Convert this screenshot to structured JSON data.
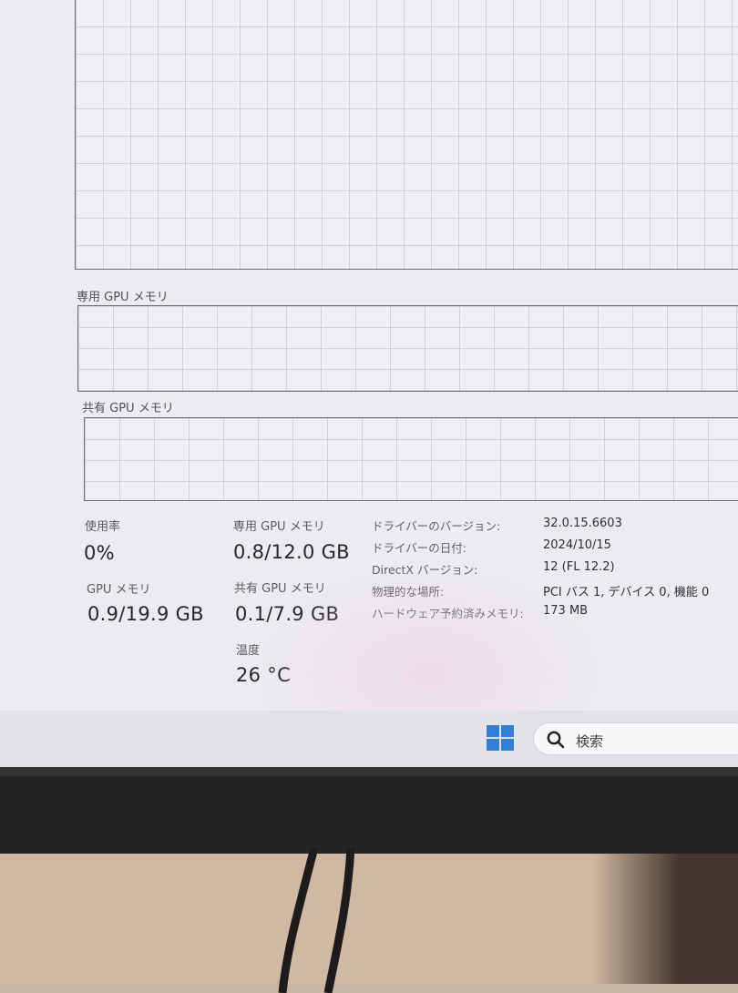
{
  "graphs": {
    "dedicated_label": "専用 GPU メモリ",
    "shared_label": "共有 GPU メモリ"
  },
  "stats": {
    "usage_label": "使用率",
    "usage_value": "0%",
    "gpu_memory_label": "GPU メモリ",
    "gpu_memory_value": "0.9/19.9 GB",
    "dedicated_label": "専用 GPU メモリ",
    "dedicated_value": "0.8/12.0 GB",
    "shared_label": "共有 GPU メモリ",
    "shared_value": "0.1/7.9 GB",
    "temp_label": "温度",
    "temp_value": "26 °C"
  },
  "info": {
    "driver_version_label": "ドライバーのバージョン:",
    "driver_version_value": "32.0.15.6603",
    "driver_date_label": "ドライバーの日付:",
    "driver_date_value": "2024/10/15",
    "directx_label": "DirectX バージョン:",
    "directx_value": "12 (FL 12.2)",
    "location_label": "物理的な場所:",
    "location_value": "PCI バス 1, デバイス 0, 機能 0",
    "reserved_label": "ハードウェア予約済みメモリ:",
    "reserved_value": "173 MB"
  },
  "taskbar": {
    "start_icon": "windows-logo-icon",
    "search_icon": "search-icon",
    "search_placeholder": "検索",
    "accent_color": "#2f7fd4"
  }
}
